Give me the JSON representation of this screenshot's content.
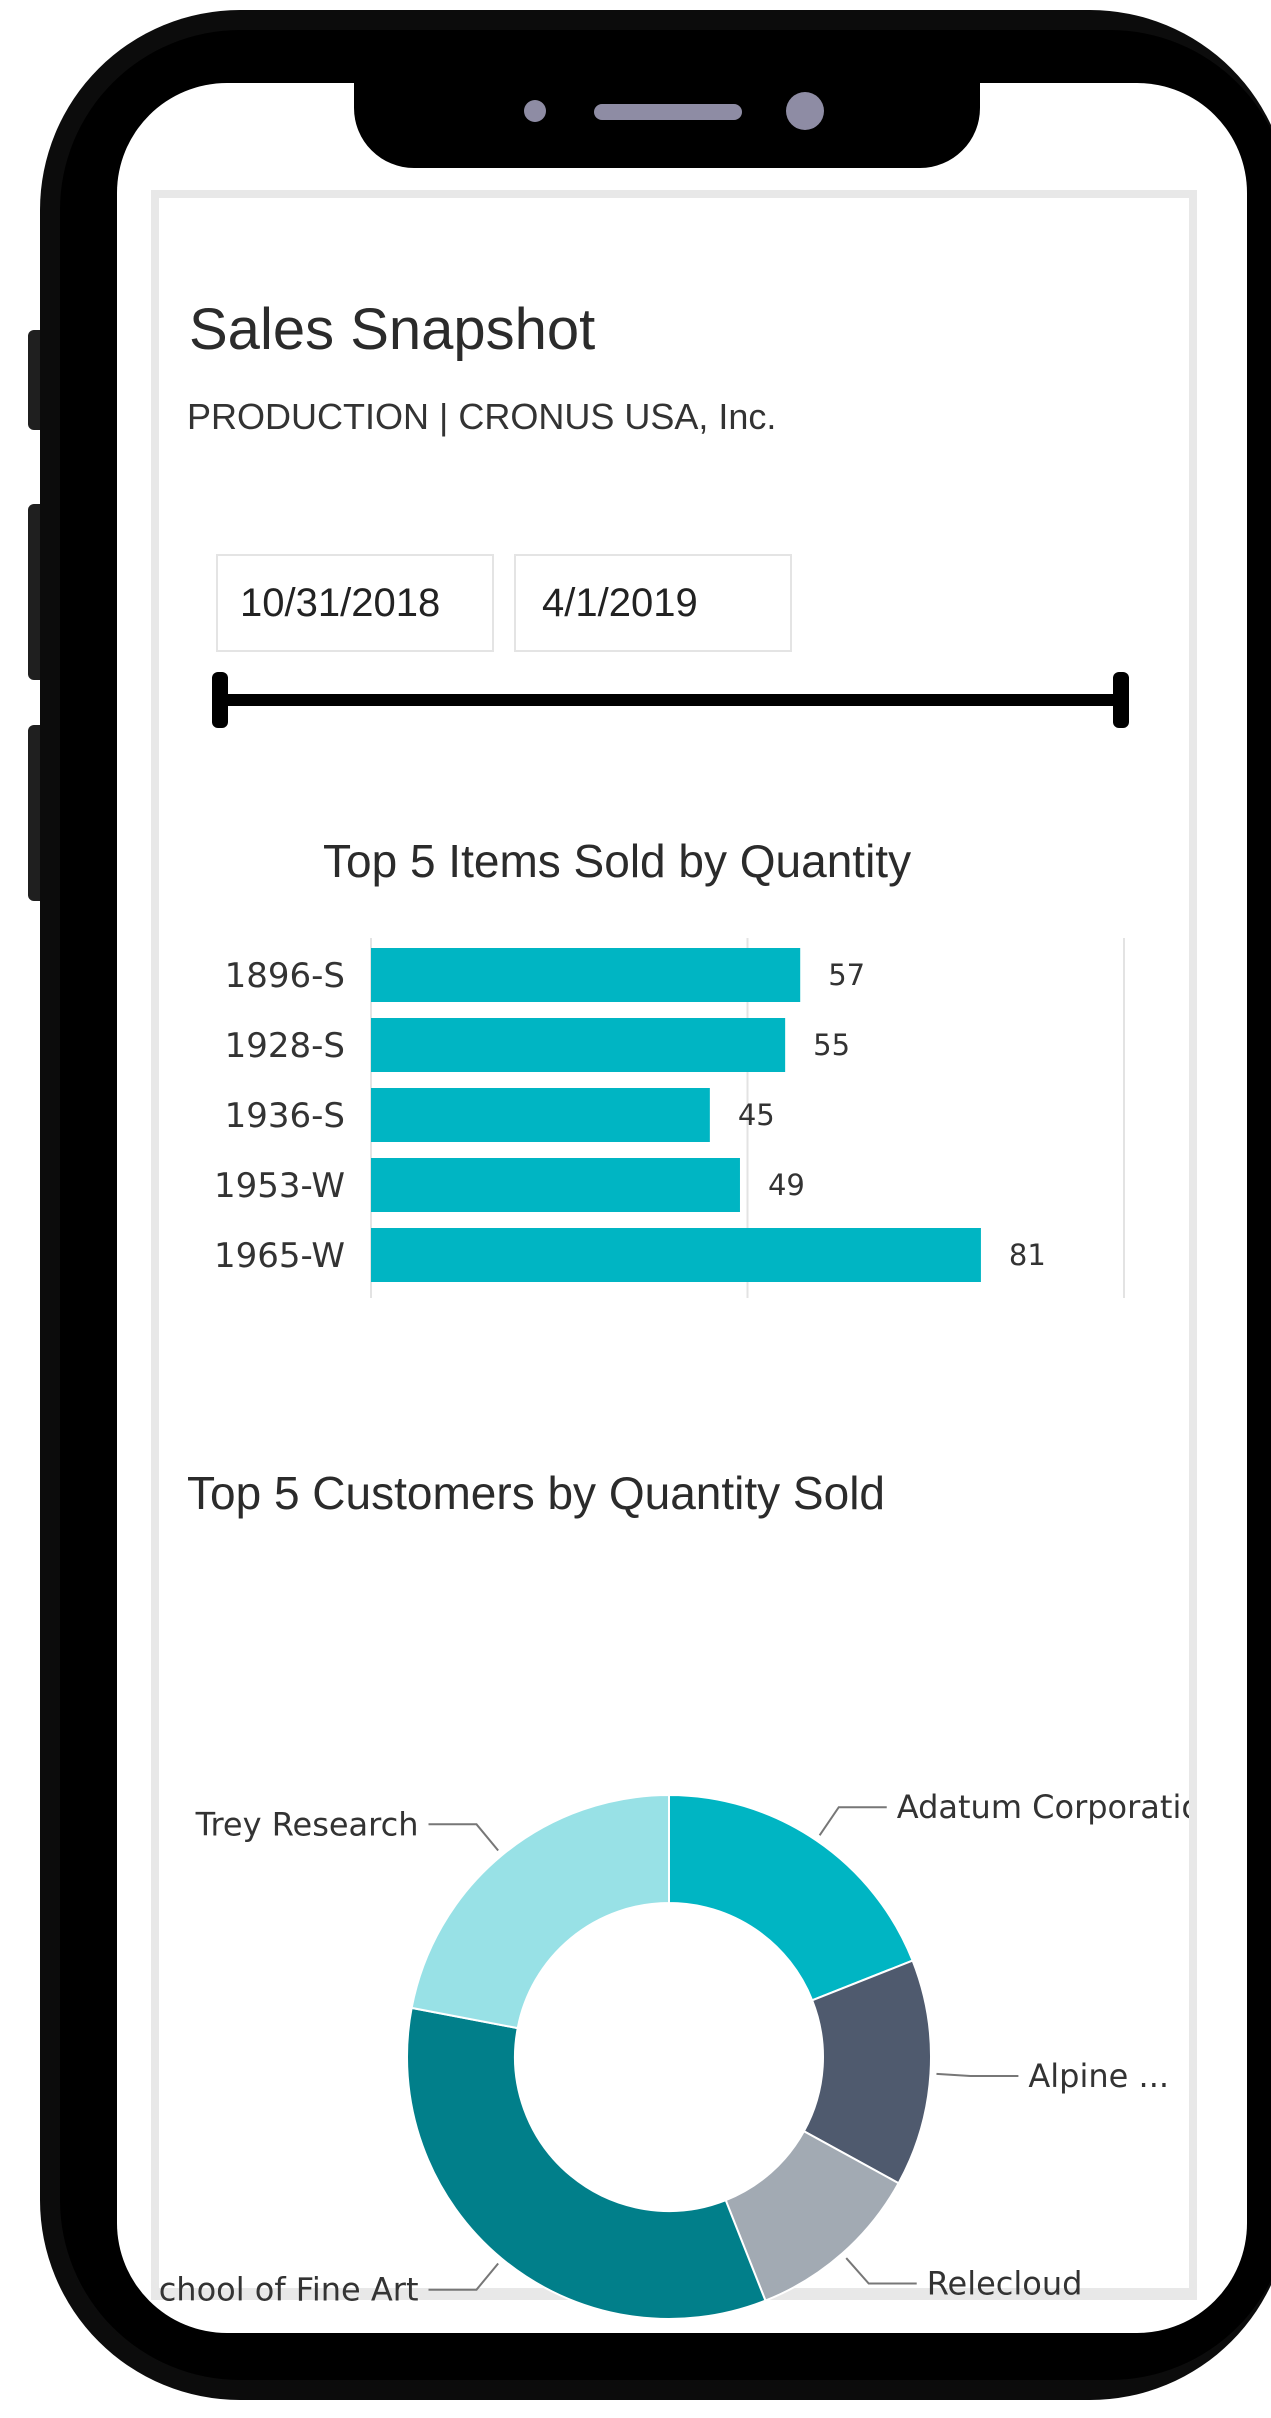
{
  "app": {
    "title": "Sales Snapshot",
    "subtitle": "PRODUCTION | CRONUS USA, Inc."
  },
  "filters": {
    "start_date": "10/31/2018",
    "end_date": "4/1/2019",
    "range_slider": {
      "start_position": 0,
      "end_position": 1
    }
  },
  "colors": {
    "bar": "#00b5c3",
    "pie": [
      "#00b5c3",
      "#4f5a6e",
      "#a2aab3",
      "#017f8a",
      "#98e1e6"
    ]
  },
  "chart_data": [
    {
      "type": "bar",
      "orientation": "horizontal",
      "title": "Top 5 Items Sold by Quantity",
      "categories": [
        "1896-S",
        "1928-S",
        "1936-S",
        "1953-W",
        "1965-W"
      ],
      "values": [
        57,
        55,
        45,
        49,
        81
      ],
      "data_labels": [
        "57",
        "55",
        "45",
        "49",
        "81"
      ],
      "x_ticks": [
        "0",
        "50",
        "100"
      ],
      "xlim": [
        0,
        100
      ],
      "grid": true
    },
    {
      "type": "pie",
      "variant": "donut",
      "title": "Top 5 Customers by Quantity Sold",
      "labels": [
        "Adatum Corporatio...",
        "Alpine ...",
        "Relecloud",
        "School of Fine Art",
        "Trey Research"
      ],
      "values": [
        19,
        14,
        11,
        34,
        22
      ]
    }
  ]
}
